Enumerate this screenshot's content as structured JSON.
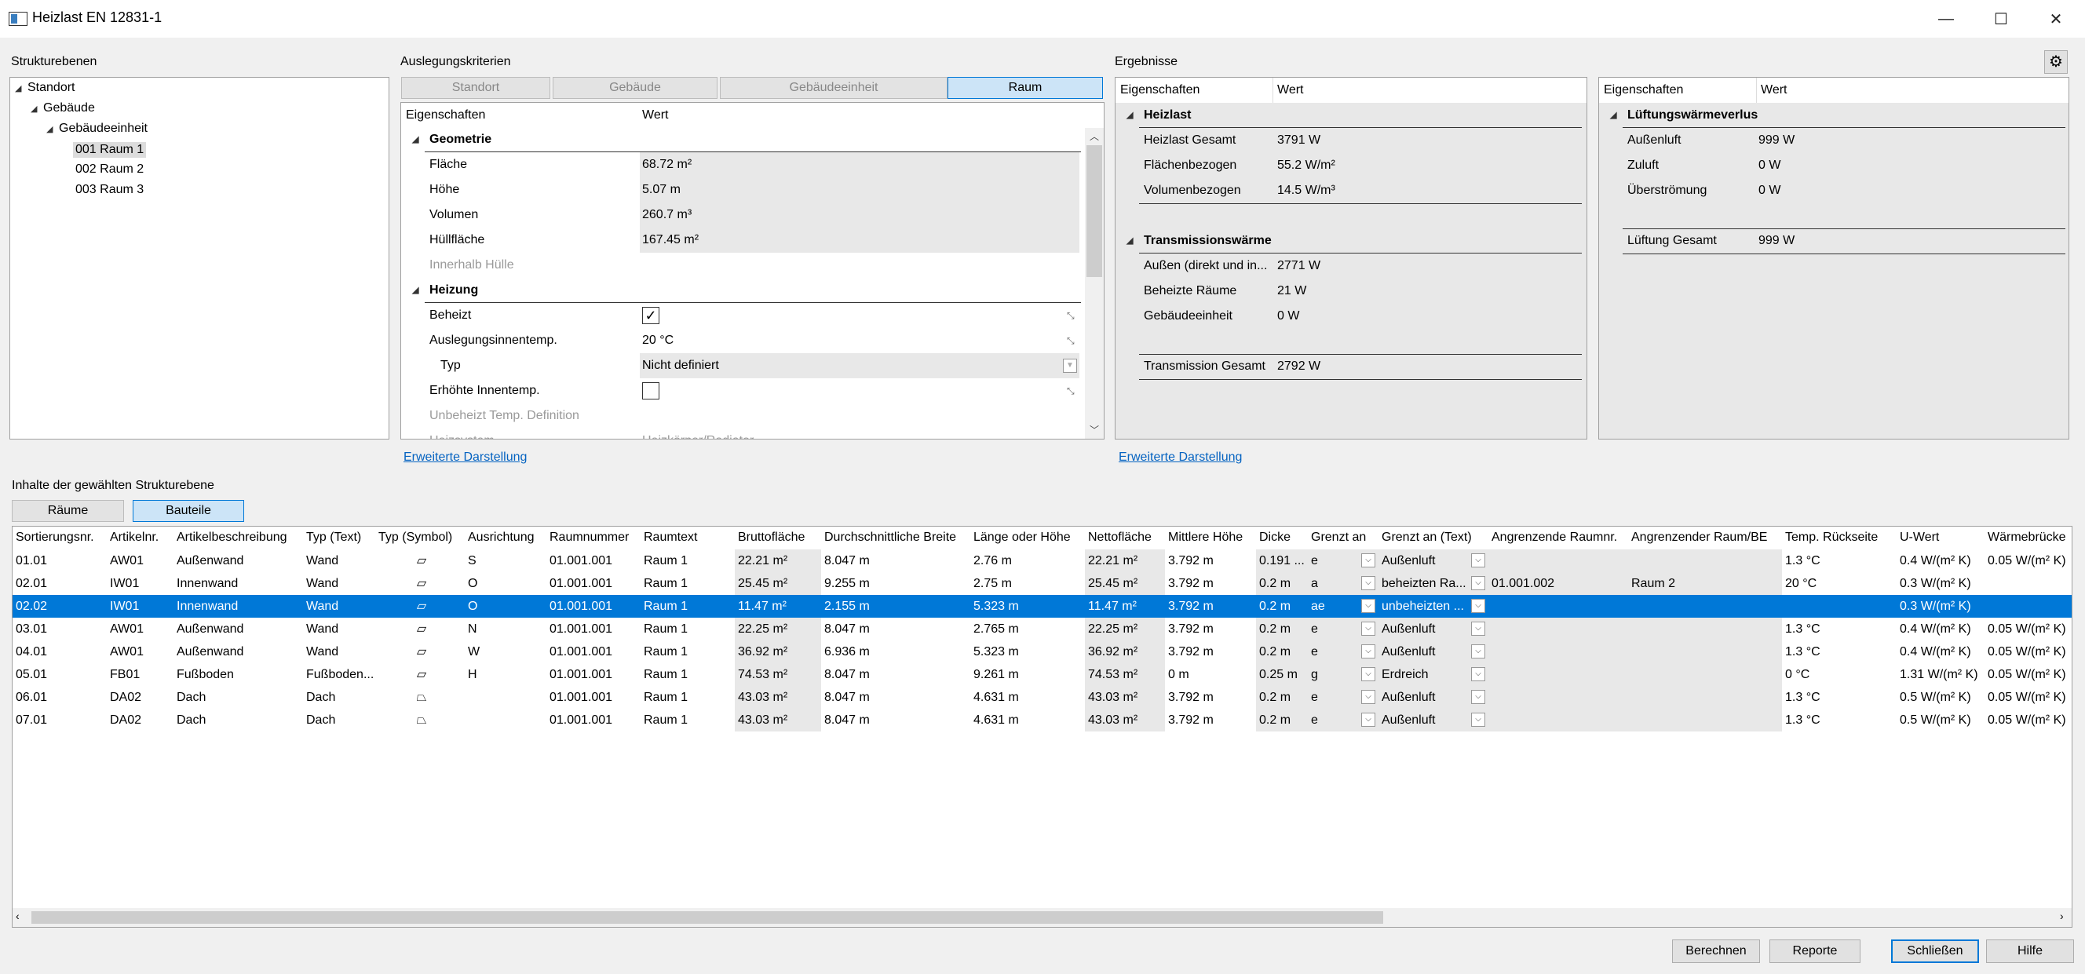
{
  "window": {
    "title": "Heizlast EN 12831-1",
    "minimize": "—",
    "maximize": "☐",
    "close": "✕"
  },
  "structure": {
    "label": "Strukturebenen",
    "items": [
      {
        "label": "Standort"
      },
      {
        "label": "Gebäude"
      },
      {
        "label": "Gebäudeeinheit"
      },
      {
        "label": "001 Raum 1"
      },
      {
        "label": "002 Raum 2"
      },
      {
        "label": "003 Raum 3"
      }
    ]
  },
  "criteria": {
    "label": "Auslegungskriterien",
    "tabs": [
      "Standort",
      "Gebäude",
      "Gebäudeeinheit",
      "Raum"
    ],
    "col_props": "Eigenschaften",
    "col_value": "Wert",
    "groups": {
      "geometrie": "Geometrie",
      "heizung": "Heizung"
    },
    "rows": [
      {
        "label": "Fläche",
        "value": "68.72 m²"
      },
      {
        "label": "Höhe",
        "value": "5.07 m"
      },
      {
        "label": "Volumen",
        "value": "260.7 m³"
      },
      {
        "label": "Hüllfläche",
        "value": "167.45 m²"
      },
      {
        "label": "Innerhalb Hülle",
        "value": ""
      },
      {
        "label": "Beheizt",
        "value": "✓"
      },
      {
        "label": "Auslegungsinnentemp.",
        "value": "20 °C"
      },
      {
        "label": "Typ",
        "value": "Nicht definiert"
      },
      {
        "label": "Erhöhte Innentemp.",
        "value": ""
      },
      {
        "label": "Unbeheizt Temp. Definition",
        "value": ""
      },
      {
        "label": "Heizsystem",
        "value": "Heizkörper/Radiator"
      }
    ],
    "link": "Erweiterte Darstellung"
  },
  "results": {
    "label": "Ergebnisse",
    "col_props": "Eigenschaften",
    "col_value": "Wert",
    "heizlast": {
      "title": "Heizlast",
      "rows": [
        {
          "label": "Heizlast Gesamt",
          "value": "3791 W"
        },
        {
          "label": "Flächenbezogen",
          "value": "55.2 W/m²"
        },
        {
          "label": "Volumenbezogen",
          "value": "14.5 W/m³"
        }
      ]
    },
    "transmission": {
      "title": "Transmissionswärme",
      "rows": [
        {
          "label": "Außen (direkt und in...",
          "value": "2771 W"
        },
        {
          "label": "Beheizte Räume",
          "value": "21 W"
        },
        {
          "label": "Gebäudeeinheit",
          "value": "0 W"
        }
      ],
      "total_label": "Transmission Gesamt",
      "total_value": "2792 W"
    },
    "lueftung": {
      "title": "Lüftungswärmeverlus",
      "rows": [
        {
          "label": "Außenluft",
          "value": "999 W"
        },
        {
          "label": "Zuluft",
          "value": "0 W"
        },
        {
          "label": "Überströmung",
          "value": "0 W"
        }
      ],
      "total_label": "Lüftung Gesamt",
      "total_value": "999 W"
    },
    "link": "Erweiterte Darstellung"
  },
  "contents": {
    "label": "Inhalte der gewählten Strukturebene",
    "tabs": [
      "Räume",
      "Bauteile"
    ],
    "columns": [
      "Sortierungsnr.",
      "Artikelnr.",
      "Artikelbeschreibung",
      "Typ (Text)",
      "Typ (Symbol)",
      "Ausrichtung",
      "Raumnummer",
      "Raumtext",
      "Bruttofläche",
      "Durchschnittliche Breite",
      "Länge oder Höhe",
      "Nettofläche",
      "Mittlere Höhe",
      "Dicke",
      "Grenzt an",
      "Grenzt an  (Text)",
      "Angrenzende Raumnr.",
      "Angrenzender Raum/BE",
      "Temp. Rückseite",
      "U-Wert",
      "Wärmebrücke"
    ],
    "rows": [
      [
        "01.01",
        "AW01",
        "Außenwand",
        "Wand",
        "wall",
        "S",
        "01.001.001",
        "Raum 1",
        "22.21 m²",
        "8.047 m",
        "2.76 m",
        "22.21 m²",
        "3.792 m",
        "0.191 ...",
        "e",
        "Außenluft",
        "",
        "",
        "1.3 °C",
        "0.4 W/(m² K)",
        "0.05 W/(m² K)"
      ],
      [
        "02.01",
        "IW01",
        "Innenwand",
        "Wand",
        "wall",
        "O",
        "01.001.001",
        "Raum 1",
        "25.45 m²",
        "9.255 m",
        "2.75 m",
        "25.45 m²",
        "3.792 m",
        "0.2 m",
        "a",
        "beheizten Ra...",
        "01.001.002",
        "Raum 2",
        "20 °C",
        "0.3 W/(m² K)",
        ""
      ],
      [
        "02.02",
        "IW01",
        "Innenwand",
        "Wand",
        "wall",
        "O",
        "01.001.001",
        "Raum 1",
        "11.47 m²",
        "2.155 m",
        "5.323 m",
        "11.47 m²",
        "3.792 m",
        "0.2 m",
        "ae",
        "unbeheizten ...",
        "",
        "",
        "",
        "0.3 W/(m² K)",
        ""
      ],
      [
        "03.01",
        "AW01",
        "Außenwand",
        "Wand",
        "wall",
        "N",
        "01.001.001",
        "Raum 1",
        "22.25 m²",
        "8.047 m",
        "2.765 m",
        "22.25 m²",
        "3.792 m",
        "0.2 m",
        "e",
        "Außenluft",
        "",
        "",
        "1.3 °C",
        "0.4 W/(m² K)",
        "0.05 W/(m² K)"
      ],
      [
        "04.01",
        "AW01",
        "Außenwand",
        "Wand",
        "wall",
        "W",
        "01.001.001",
        "Raum 1",
        "36.92 m²",
        "6.936 m",
        "5.323 m",
        "36.92 m²",
        "3.792 m",
        "0.2 m",
        "e",
        "Außenluft",
        "",
        "",
        "1.3 °C",
        "0.4 W/(m² K)",
        "0.05 W/(m² K)"
      ],
      [
        "05.01",
        "FB01",
        "Fußboden",
        "Fußboden...",
        "floor",
        "H",
        "01.001.001",
        "Raum 1",
        "74.53 m²",
        "8.047 m",
        "9.261 m",
        "74.53 m²",
        "0 m",
        "0.25 m",
        "g",
        "Erdreich",
        "",
        "",
        "0 °C",
        "1.31 W/(m² K)",
        "0.05 W/(m² K)"
      ],
      [
        "06.01",
        "DA02",
        "Dach",
        "Dach",
        "roof",
        "",
        "01.001.001",
        "Raum 1",
        "43.03 m²",
        "8.047 m",
        "4.631 m",
        "43.03 m²",
        "3.792 m",
        "0.2 m",
        "e",
        "Außenluft",
        "",
        "",
        "1.3 °C",
        "0.5 W/(m² K)",
        "0.05 W/(m² K)"
      ],
      [
        "07.01",
        "DA02",
        "Dach",
        "Dach",
        "roof",
        "",
        "01.001.001",
        "Raum 1",
        "43.03 m²",
        "8.047 m",
        "4.631 m",
        "43.03 m²",
        "3.792 m",
        "0.2 m",
        "e",
        "Außenluft",
        "",
        "",
        "1.3 °C",
        "0.5 W/(m² K)",
        "0.05 W/(m² K)"
      ]
    ]
  },
  "footer": {
    "buttons": [
      "Berechnen",
      "Reporte",
      "Schließen",
      "Hilfe"
    ]
  },
  "colors": {
    "accent": "#0078d7",
    "selected_tab": "#cce4f7",
    "link": "#0563c1"
  }
}
